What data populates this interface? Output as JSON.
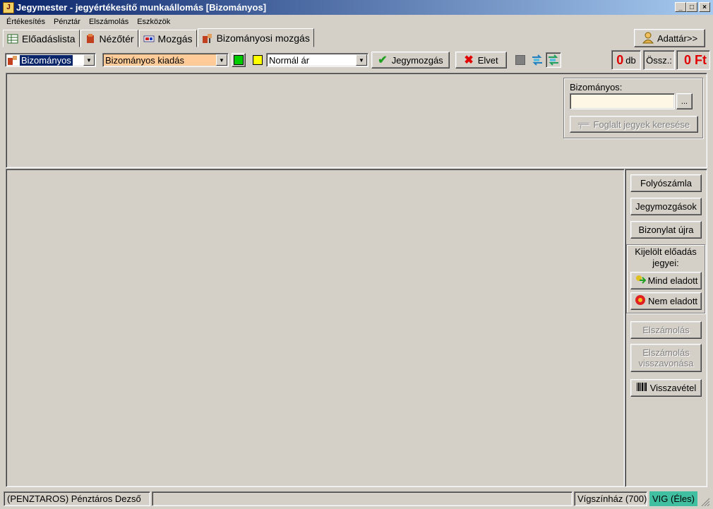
{
  "window": {
    "title": "Jegymester - jegyértékesítő munkaállomás [Bizományos]",
    "app_icon": "ticket-app-icon"
  },
  "menu": [
    "Értékesítés",
    "Pénztár",
    "Elszámolás",
    "Eszközök"
  ],
  "tabs": [
    {
      "label": "Előadáslista",
      "icon": "table-icon"
    },
    {
      "label": "Nézőtér",
      "icon": "theater-icon"
    },
    {
      "label": "Mozgás",
      "icon": "movement-icon"
    },
    {
      "label": "Bizományosi mozgás",
      "icon": "consignment-icon",
      "active": true
    }
  ],
  "adattar_label": "Adattár>>",
  "toolbar": {
    "combo_bizomanyos": "Bizományos",
    "combo_kiadas": "Bizományos kiadás",
    "combo_ar": "Normál ár",
    "jegymozgas_label": "Jegymozgás",
    "elvet_label": "Elvet",
    "count_value": "0",
    "count_unit": "db",
    "ossz_label": "Össz.:",
    "ossz_value": "0 Ft",
    "colors": {
      "green": "#00cc00",
      "yellow": "#ffff00",
      "kiadas_bg": "#ffcc99"
    }
  },
  "bizomanyos_panel": {
    "label": "Bizományos:",
    "input_value": "",
    "browse_label": "...",
    "search_label": "Foglalt jegyek keresése"
  },
  "right_panel": {
    "folyoszamla": "Folyószámla",
    "jegymozgasok": "Jegymozgások",
    "bizonylat": "Bizonylat újra",
    "kijelolt_label": "Kijelölt előadás jegyei:",
    "mind_eladott": "Mind eladott",
    "nem_eladott": "Nem eladott",
    "elszamolas": "Elszámolás",
    "elszamolas_vissza": "Elszámolás visszavonása",
    "visszavetel": "Visszavétel"
  },
  "status": {
    "user": "(PENZTAROS) Pénztáros Dezső",
    "venue": "Vígszínház (700)",
    "env": "VIG (Éles)",
    "env_color": "#40c0a0"
  }
}
